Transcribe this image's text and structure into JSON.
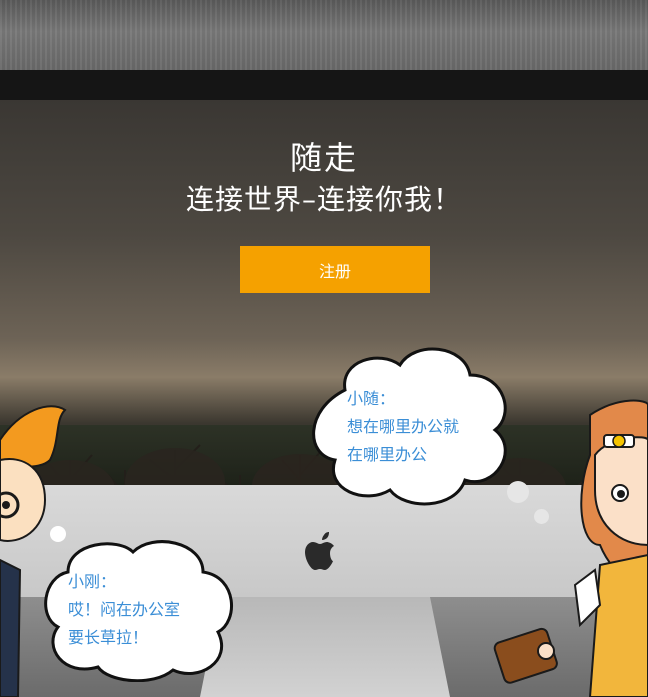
{
  "hero": {
    "title": "随走",
    "subtitle": "连接世界–连接你我！",
    "register_label": "注册"
  },
  "bubbles": {
    "right": {
      "name": "小随：",
      "line1": "想在哪里办公就",
      "line2": "在哪里办公"
    },
    "left": {
      "name": "小刚：",
      "line1": "哎！闷在办公室",
      "line2": "要长草拉！"
    }
  },
  "icons": {
    "logo": "apple-logo-icon"
  },
  "colors": {
    "accent": "#f5a100",
    "bubble_text": "#3b8ed6"
  }
}
